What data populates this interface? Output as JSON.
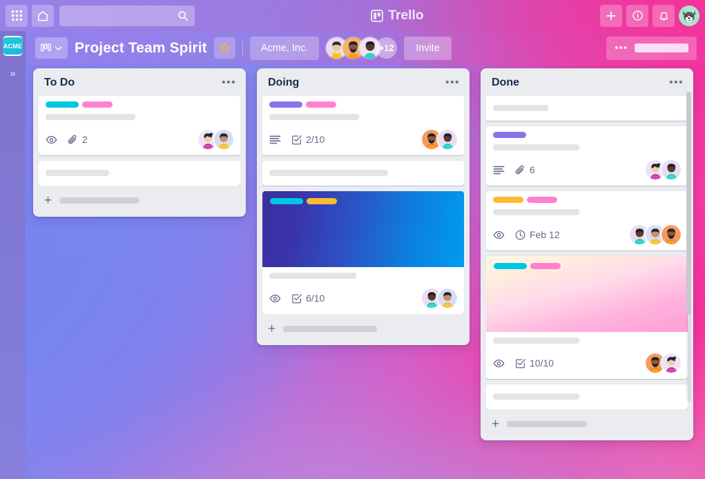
{
  "topbar": {
    "apps_icon": "grid-apps-icon",
    "home_icon": "home-icon",
    "search_placeholder": "",
    "search_icon": "search-icon",
    "brand_name": "Trello",
    "brand_icon": "trello-board-icon",
    "add_icon": "plus-icon",
    "info_icon": "info-circle-icon",
    "notifications_icon": "bell-icon",
    "avatar_icon": "dog-avatar"
  },
  "rail": {
    "workspace_badge": "ACME",
    "expand_icon": "double-chevron-right-icon"
  },
  "boardbar": {
    "switcher_icon": "board-columns-icon",
    "switcher_chevron": "chevron-down-icon",
    "board_title": "Project Team Spirit",
    "star_icon": "star-icon",
    "team_name": "Acme, Inc.",
    "members_overflow": "+12",
    "invite_label": "Invite",
    "menu_dots": "•••"
  },
  "colors": {
    "label_cyan": "#00c7e0",
    "label_pink": "#ff80ce",
    "label_purple": "#8477eb",
    "label_yellow": "#fbbb33",
    "list_bg": "#ebecf0",
    "card_bg": "#ffffff",
    "text_dark": "#172b4d",
    "text_muted": "#5e6c84",
    "acme_teal": "#1cc3da"
  },
  "lists": [
    {
      "title": "To Do",
      "menu": "•••",
      "add_card_label": "",
      "has_scrollbar": false,
      "cards": [
        {
          "type": "standard",
          "labels": [
            "#00c7e0",
            "#ff80ce"
          ],
          "title_placeholder": true,
          "title_width": 130,
          "badges": [
            {
              "icon": "eye-icon",
              "text": ""
            },
            {
              "icon": "paperclip-icon",
              "text": "2"
            }
          ],
          "avatars": [
            "purple-shirt-woman",
            "yellow-shirt-person"
          ]
        },
        {
          "type": "plain",
          "title_width": 92
        }
      ]
    },
    {
      "title": "Doing",
      "menu": "•••",
      "add_card_label": "",
      "has_scrollbar": false,
      "cards": [
        {
          "type": "standard",
          "labels": [
            "#8477eb",
            "#ff80ce"
          ],
          "title_placeholder": true,
          "title_width": 130,
          "badges": [
            {
              "icon": "description-icon",
              "text": ""
            },
            {
              "icon": "checklist-icon",
              "text": "2/10"
            }
          ],
          "avatars": [
            "orange-beard-man",
            "teal-shirt-woman"
          ]
        },
        {
          "type": "plain",
          "title_width": 172
        },
        {
          "type": "cover",
          "cover_gradient": "linear-gradient(100deg, #3b2f9e 0%, #3a34ab 18%, #2a55c6 45%, #0b82e0 75%, #009bf0 100%)",
          "labels": [
            "#00c7e0",
            "#fbbb33"
          ],
          "title_width": 126,
          "badges": [
            {
              "icon": "eye-icon",
              "text": ""
            },
            {
              "icon": "checklist-icon",
              "text": "6/10"
            }
          ],
          "avatars": [
            "teal-shirt-woman",
            "yellow-shirt-person"
          ]
        }
      ]
    },
    {
      "title": "Done",
      "menu": "•••",
      "add_card_label": "",
      "has_scrollbar": true,
      "cards": [
        {
          "type": "plain",
          "title_width": 80
        },
        {
          "type": "standard",
          "labels": [
            "#8477eb"
          ],
          "title_placeholder": true,
          "title_width": 125,
          "badges": [
            {
              "icon": "description-icon",
              "text": ""
            },
            {
              "icon": "paperclip-icon",
              "text": "6"
            }
          ],
          "avatars": [
            "purple-shirt-woman",
            "teal-shirt-woman"
          ]
        },
        {
          "type": "standard",
          "labels": [
            "#fbbb33",
            "#ff80ce"
          ],
          "title_placeholder": true,
          "title_width": 125,
          "badges": [
            {
              "icon": "eye-icon",
              "text": ""
            },
            {
              "icon": "clock-icon",
              "text": "Feb 12"
            }
          ],
          "avatars": [
            "teal-shirt-woman",
            "yellow-shirt-person",
            "orange-beard-man"
          ]
        },
        {
          "type": "cover",
          "cover_gradient": "linear-gradient(165deg, #fff8e8 0%, #ffeede 18%, #ffd9e8 45%, #ffb3dd 72%, #ff9ed4 100%)",
          "labels": [
            "#00c7e0",
            "#ff80ce"
          ],
          "title_width": 125,
          "badges": [
            {
              "icon": "eye-icon",
              "text": ""
            },
            {
              "icon": "checklist-icon",
              "text": "10/10"
            }
          ],
          "avatars": [
            "orange-beard-man",
            "purple-shirt-woman"
          ]
        },
        {
          "type": "plain",
          "title_width": 125
        }
      ]
    }
  ]
}
